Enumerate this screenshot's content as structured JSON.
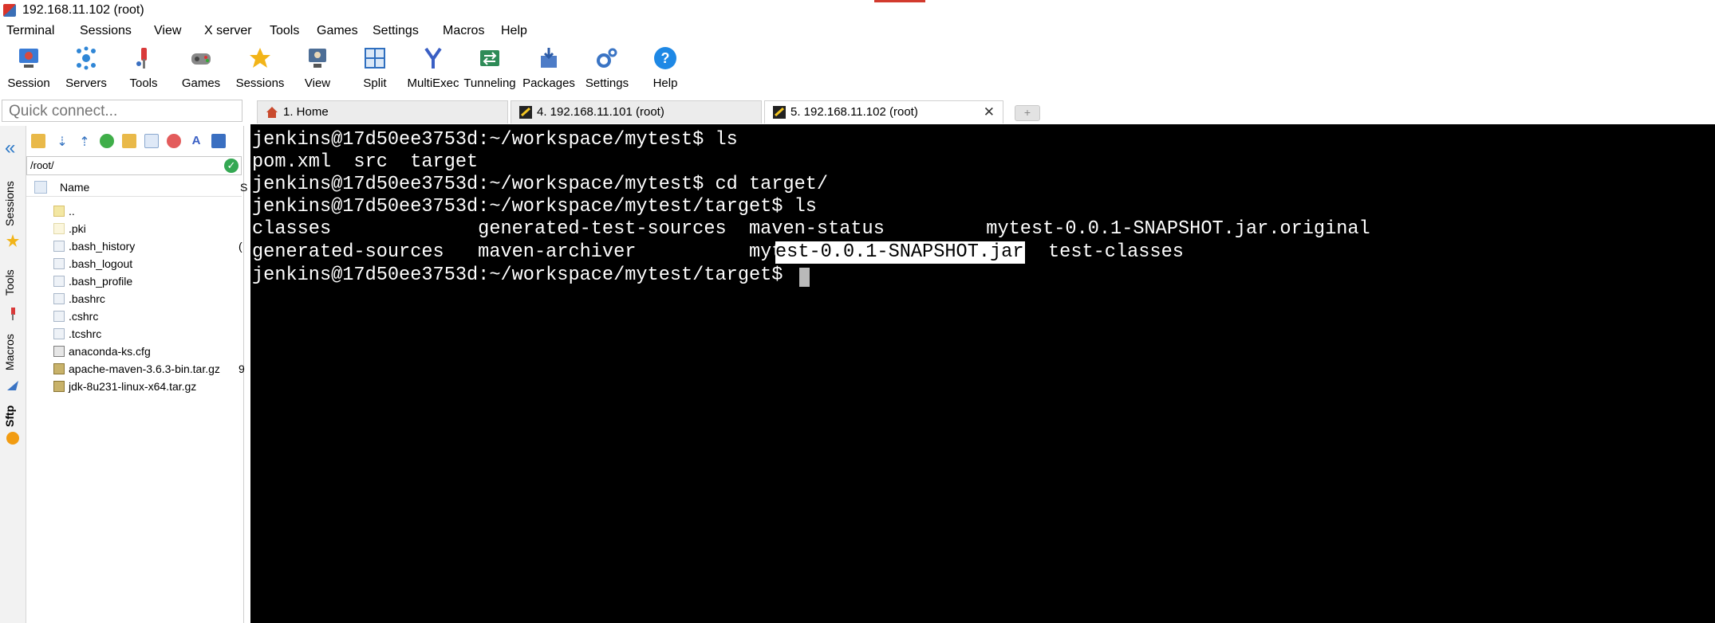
{
  "window": {
    "title": "192.168.11.102 (root)"
  },
  "menu": [
    "Terminal",
    "Sessions",
    "View",
    "X server",
    "Tools",
    "Games",
    "Settings",
    "Macros",
    "Help"
  ],
  "toolbar": [
    {
      "label": "Session",
      "icon": "session-icon"
    },
    {
      "label": "Servers",
      "icon": "servers-icon"
    },
    {
      "label": "Tools",
      "icon": "tools-icon"
    },
    {
      "label": "Games",
      "icon": "games-icon"
    },
    {
      "label": "Sessions",
      "icon": "star-icon"
    },
    {
      "label": "View",
      "icon": "view-icon"
    },
    {
      "label": "Split",
      "icon": "split-icon"
    },
    {
      "label": "MultiExec",
      "icon": "multiexec-icon"
    },
    {
      "label": "Tunneling",
      "icon": "tunneling-icon"
    },
    {
      "label": "Packages",
      "icon": "packages-icon"
    },
    {
      "label": "Settings",
      "icon": "gears-icon"
    },
    {
      "label": "Help",
      "icon": "help-icon"
    }
  ],
  "quick_connect": {
    "placeholder": "Quick connect..."
  },
  "tabs": [
    {
      "label": "1. Home",
      "active": false
    },
    {
      "label": "4. 192.168.11.101 (root)",
      "active": false
    },
    {
      "label": "5. 192.168.11.102 (root)",
      "active": true
    }
  ],
  "side_tabs": [
    "Sessions",
    "Tools",
    "Macros",
    "Sftp"
  ],
  "sftp": {
    "path": "/root/",
    "header": {
      "name": "Name",
      "size": "S"
    },
    "files": [
      {
        "name": "..",
        "size": "",
        "type": "folder"
      },
      {
        "name": ".pki",
        "size": "",
        "type": "folder"
      },
      {
        "name": ".bash_history",
        "size": "(",
        "type": "file"
      },
      {
        "name": ".bash_logout",
        "size": "",
        "type": "file"
      },
      {
        "name": ".bash_profile",
        "size": "",
        "type": "file"
      },
      {
        "name": ".bashrc",
        "size": "",
        "type": "file"
      },
      {
        "name": ".cshrc",
        "size": "",
        "type": "file"
      },
      {
        "name": ".tcshrc",
        "size": "",
        "type": "file"
      },
      {
        "name": "anaconda-ks.cfg",
        "size": "",
        "type": "cfg"
      },
      {
        "name": "apache-maven-3.6.3-bin.tar.gz",
        "size": "9",
        "type": "archive"
      },
      {
        "name": "jdk-8u231-linux-x64.tar.gz",
        "size": "",
        "type": "archive"
      }
    ]
  },
  "terminal": {
    "lines": [
      "jenkins@17d50ee3753d:~/workspace/mytest$ ls",
      "pom.xml  src  target",
      "jenkins@17d50ee3753d:~/workspace/mytest$ cd target/",
      "jenkins@17d50ee3753d:~/workspace/mytest/target$ ls",
      "classes             generated-test-sources  maven-status         mytest-0.0.1-SNAPSHOT.jar.original",
      "generated-sources   maven-archiver          myt",
      "jenkins@17d50ee3753d:~/workspace/mytest/target$ "
    ],
    "highlighted": "est-0.0.1-SNAPSHOT.jar",
    "after_highlight": "test-classes"
  },
  "colors": {
    "terminal_bg": "#000000",
    "terminal_fg": "#ffffff",
    "selection_bg": "#ffffff"
  }
}
